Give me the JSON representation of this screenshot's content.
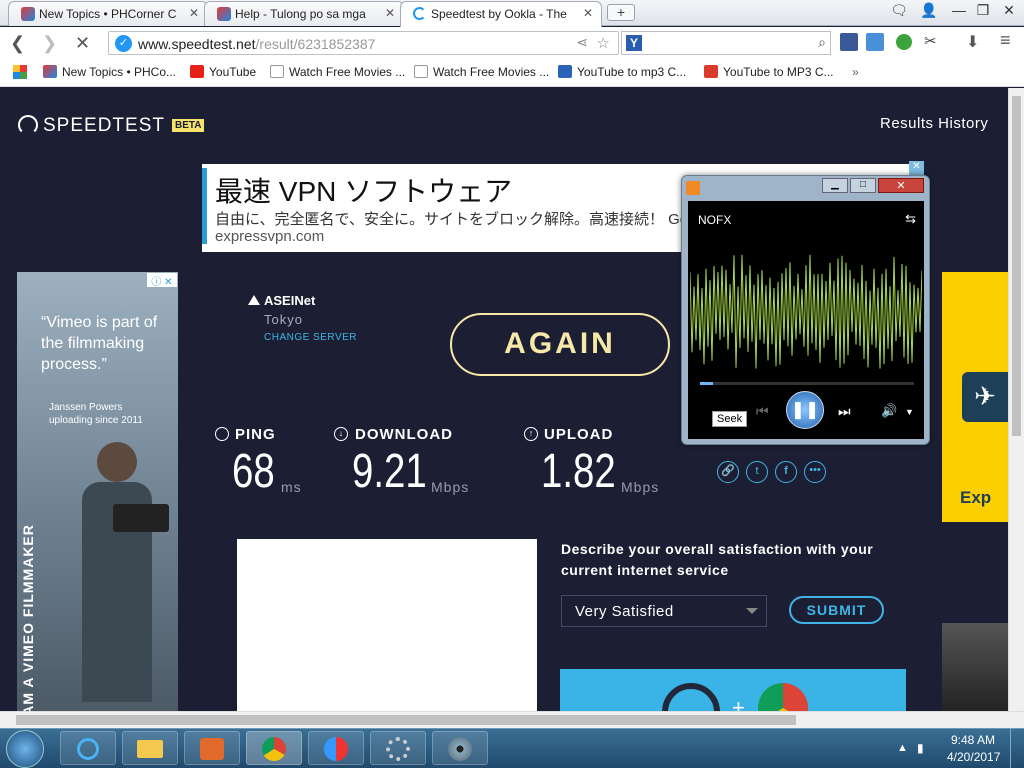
{
  "tabs": [
    {
      "label": "New Topics • PHCorner C",
      "icon": "phcorner-icon"
    },
    {
      "label": "Help - Tulong po sa mga",
      "icon": "phcorner-icon"
    },
    {
      "label": "Speedtest by Ookla - The",
      "icon": "loading-icon"
    }
  ],
  "url": {
    "host": "www.speedtest.net",
    "path": "/result/6231852387"
  },
  "bookmarks": [
    "New Topics • PHCo...",
    "YouTube",
    "Watch Free Movies ...",
    "Watch Free Movies ...",
    "YouTube to mp3 C...",
    "YouTube to MP3 C..."
  ],
  "speedtest": {
    "logo": "SPEEDTEST",
    "beta": "BETA",
    "results_history": "Results History",
    "isp": "ASEINet",
    "city": "Tokyo",
    "change_server": "CHANGE SERVER",
    "again": "AGAIN",
    "ping_label": "PING",
    "ping_value": "68",
    "ping_unit": "ms",
    "download_label": "DOWNLOAD",
    "download_value": "9.21",
    "download_unit": "Mbps",
    "upload_label": "UPLOAD",
    "upload_value": "1.82",
    "upload_unit": "Mbps",
    "survey_q": "Describe your overall satisfaction with your current internet service",
    "survey_answer": "Very Satisfied",
    "submit": "SUBMIT"
  },
  "ad_top": {
    "title": "最速 VPN ソフトウェア",
    "line2": "自由に、完全匿名で、安全に。サイトをブロック解除。高速接続！ Go",
    "domain": "expressvpn.com"
  },
  "ad_left": {
    "quote": "“Vimeo is part of the filmmaking process.”",
    "author": "Janssen Powers",
    "since": "uploading since 2011",
    "vertical": "I AM A VIMEO FILMMAKER"
  },
  "ad_right": {
    "text": "Exp"
  },
  "player": {
    "track": "NOFX",
    "tooltip": "Seek",
    "progress": 0.06
  },
  "clock": {
    "time": "9:48 AM",
    "date": "4/20/2017"
  },
  "colors": {
    "accent": "#f8e8a8",
    "link": "#3fb4e6",
    "bg": "#1c1f33"
  }
}
